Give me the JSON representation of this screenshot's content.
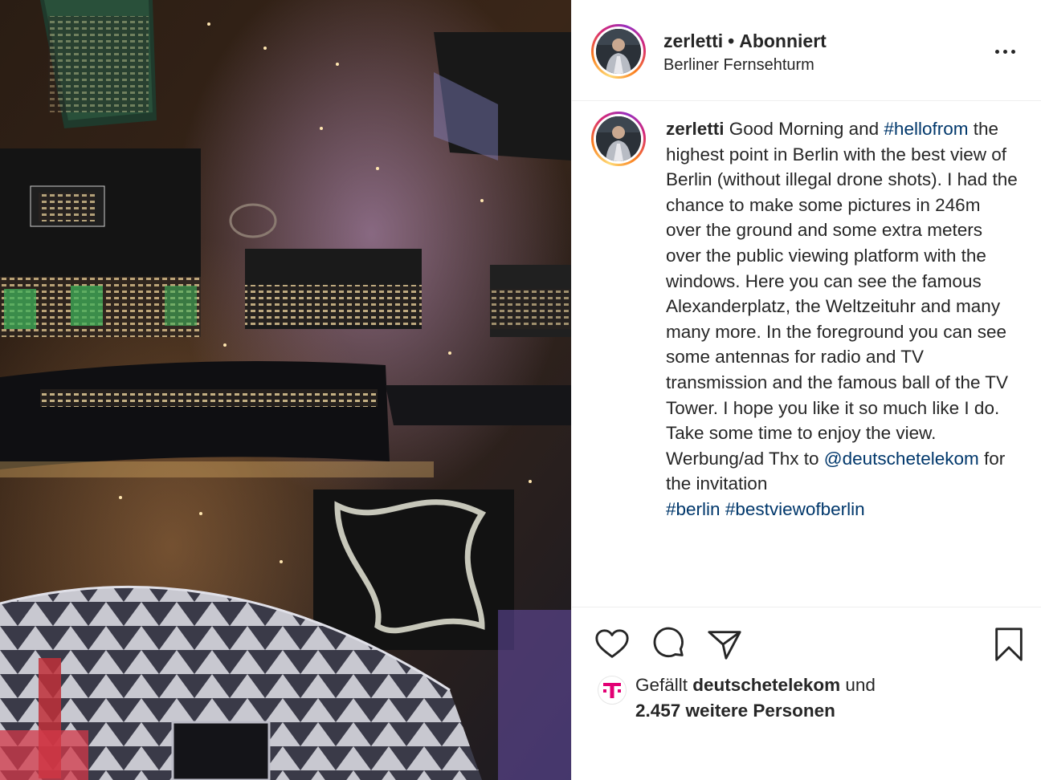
{
  "post": {
    "username": "zerletti",
    "separator": "•",
    "follow_status": "Abonniert",
    "location": "Berliner Fernsehturm"
  },
  "caption": {
    "username": "zerletti",
    "text_1": "Good Morning and ",
    "hashtag_1": "#hellofrom",
    "text_2": " the highest point in Berlin with the best view of Berlin (without illegal drone shots). I had the chance to make some pictures in 246m over the ground and some extra meters over the public viewing platform with the windows. Here you can see the famous Alexanderplatz, the Weltzeituhr and many many more. In the foreground you can see some antennas for radio and TV transmission and the famous ball of the TV Tower. I hope you like it so much like I do. Take some time to enjoy the view.",
    "text_3": "Werbung/ad Thx to ",
    "mention": "@deutschetelekom",
    "text_4": " for the invitation",
    "hashtag_2": "#berlin",
    "hashtag_3": "#bestviewofberlin"
  },
  "likes": {
    "prefix": "Gefällt ",
    "liker": "deutschetelekom",
    "suffix": " und",
    "others": "2.457 weitere Personen",
    "avatar_letter": "T",
    "avatar_color": "#e20074"
  },
  "icons": {
    "like": "heart-outline-icon",
    "comment": "speech-bubble-icon",
    "share": "paper-plane-icon",
    "save": "bookmark-icon",
    "more": "ellipsis-icon"
  },
  "colors": {
    "link": "#00376b",
    "text": "#262626",
    "divider": "#efefef"
  }
}
